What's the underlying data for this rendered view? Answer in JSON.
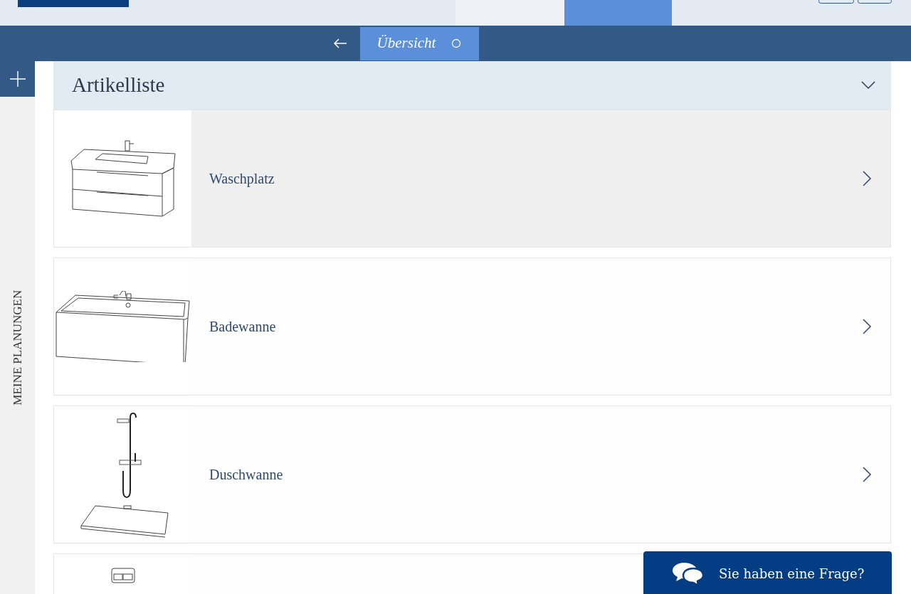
{
  "top_tabs": [
    {
      "selected": false
    },
    {
      "selected": true
    }
  ],
  "sub_bar": {
    "title": "Übersicht"
  },
  "sidebar": {
    "label": "MEINE PLANUNGEN"
  },
  "article_list": {
    "title": "Artikelliste",
    "expanded": true,
    "items": [
      {
        "kind": "vanity",
        "label": "Waschplatz",
        "selected": true
      },
      {
        "kind": "bathtub",
        "label": "Badewanne",
        "selected": false
      },
      {
        "kind": "shower",
        "label": "Duschwanne",
        "selected": false
      },
      {
        "kind": "flush",
        "selected": false
      }
    ]
  },
  "chat_button": {
    "label": "Sie haben eine Frage?"
  }
}
